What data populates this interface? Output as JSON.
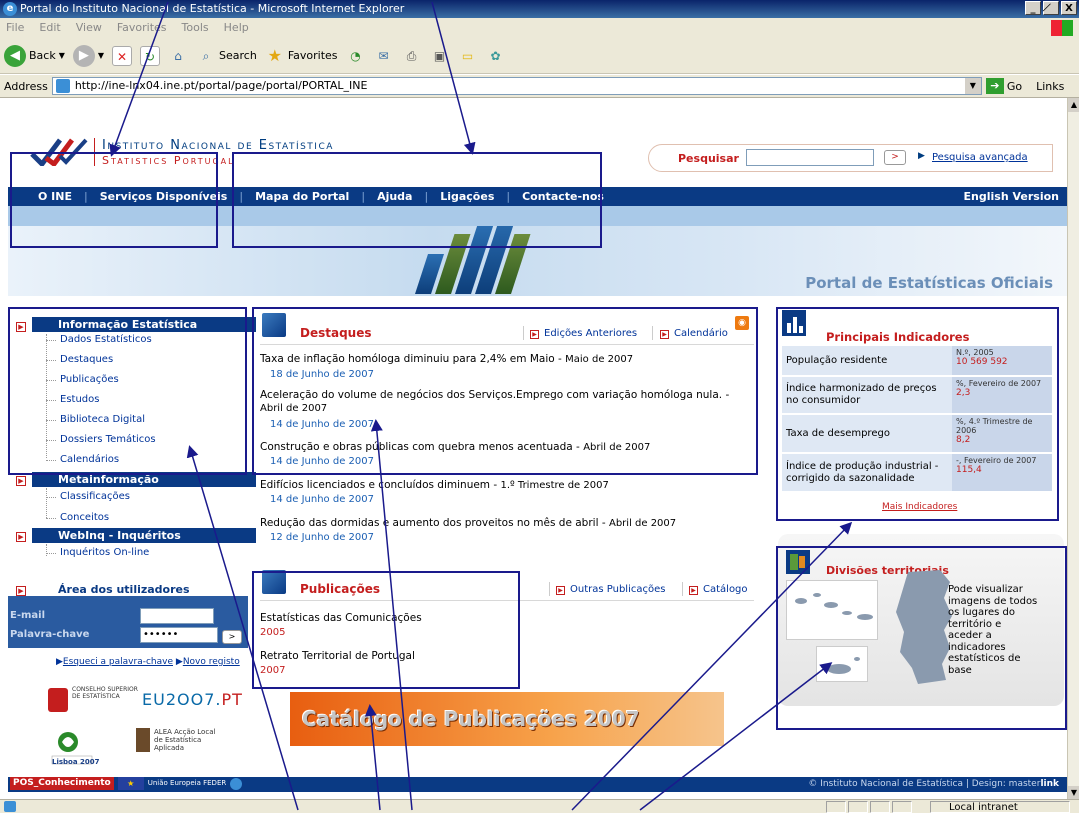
{
  "window": {
    "title": "Portal do Instituto Nacional de Estatística - Microsoft Internet Explorer",
    "controls": [
      "_",
      "̸",
      "X"
    ]
  },
  "menu": [
    "File",
    "Edit",
    "View",
    "Favorites",
    "Tools",
    "Help"
  ],
  "toolbar": {
    "back_label": "Back",
    "search_label": "Search",
    "favorites_label": "Favorites"
  },
  "address": {
    "label": "Address",
    "url": "http://ine-lnx04.ine.pt/portal/page/portal/PORTAL_INE",
    "go_label": "Go",
    "links_label": "Links"
  },
  "header": {
    "org_line1": "Instituto Nacional de Estatística",
    "org_line2": "Statistics Portugal",
    "search_label": "Pesquisar",
    "search_value": "",
    "advanced_search": "Pesquisa avançada"
  },
  "nav": {
    "items": [
      "O INE",
      "Serviços Disponíveis",
      "Mapa do Portal",
      "Ajuda",
      "Ligações",
      "Contacte-nos"
    ],
    "english": "English Version"
  },
  "banner": {
    "text": "Portal de Estatísticas Oficiais"
  },
  "sidebar": {
    "info_title": "Informação Estatística",
    "info_items": [
      "Dados Estatísticos",
      "Destaques",
      "Publicações",
      "Estudos",
      "Biblioteca Digital",
      "Dossiers Temáticos",
      "Calendários"
    ],
    "meta_title": "Metainformação",
    "meta_items": [
      "Classificações",
      "Conceitos"
    ],
    "webinq_title": "WebInq - Inquéritos",
    "webinq_items": [
      "Inquéritos On-line"
    ],
    "users_title": "Área dos utilizadores",
    "email_label": "E-mail",
    "email_value": "",
    "password_label": "Palavra-chave",
    "password_value": "••••••",
    "forgot_label": "Esqueci a palavra-chave",
    "register_label": "Novo registo"
  },
  "logos": {
    "conselho": "CONSELHO SUPERIOR DE ESTATÍSTICA",
    "eu_pre": "EU2OO7.",
    "eu_post": "PT",
    "lisboa": "Lisboa 2007",
    "alea": "ALEA Acção Local de Estatística Aplicada"
  },
  "destaques": {
    "title": "Destaques",
    "link_previous": "Edições Anteriores",
    "link_calendar": "Calendário",
    "items": [
      {
        "title": "Taxa de inflação homóloga diminuiu para 2,4% em Maio",
        "period": "Maio de 2007",
        "date": "18 de Junho de 2007"
      },
      {
        "title": "Aceleração do volume de negócios dos Serviços.Emprego com variação homóloga nula.",
        "period": "Abril de 2007",
        "date": "14 de Junho de 2007"
      },
      {
        "title": "Construção e obras públicas com quebra menos acentuada",
        "period": "Abril de 2007",
        "date": "14 de Junho de 2007"
      },
      {
        "title": "Edifícios licenciados e concluídos diminuem",
        "period": "1.º Trimestre de 2007",
        "date": "14 de Junho de 2007"
      },
      {
        "title": "Redução das dormidas e aumento dos proveitos no mês de abril",
        "period": "Abril de 2007",
        "date": "12 de Junho de 2007"
      }
    ]
  },
  "publicacoes": {
    "title": "Publicações",
    "link_other": "Outras Publicações",
    "link_catalog": "Catálogo",
    "items": [
      {
        "title": "Estatísticas das Comunicações",
        "year": "2005"
      },
      {
        "title": "Retrato Territorial de Portugal",
        "year": "2007"
      }
    ],
    "catalog_banner": "Catálogo de Publicações 2007"
  },
  "indicadores": {
    "title": "Principais Indicadores",
    "rows": [
      {
        "name": "População residente",
        "unit": "N.º, 2005",
        "value": "10 569 592"
      },
      {
        "name": "Índice harmonizado de preços no consumidor",
        "unit": "%, Fevereiro de 2007",
        "value": "2,3"
      },
      {
        "name": "Taxa de desemprego",
        "unit": "%, 4.º Trimestre de 2006",
        "value": "8,2"
      },
      {
        "name": "Índice de produção industrial - corrigido da sazonalidade",
        "unit": "-, Fevereiro de 2007",
        "value": "115,4"
      }
    ],
    "more": "Mais Indicadores"
  },
  "divisoes": {
    "title": "Divisões territoriais",
    "text": "Pode visualizar imagens de todos os lugares do território e aceder a indicadores estatísticos de base"
  },
  "footer": {
    "posc": "POS_Conhecimento",
    "eu_union": "União Europeia FEDER",
    "copyright": "© Instituto Nacional de Estatística  |  Design: master",
    "design_bold": "link"
  },
  "status": {
    "zone": "Local intranet"
  }
}
